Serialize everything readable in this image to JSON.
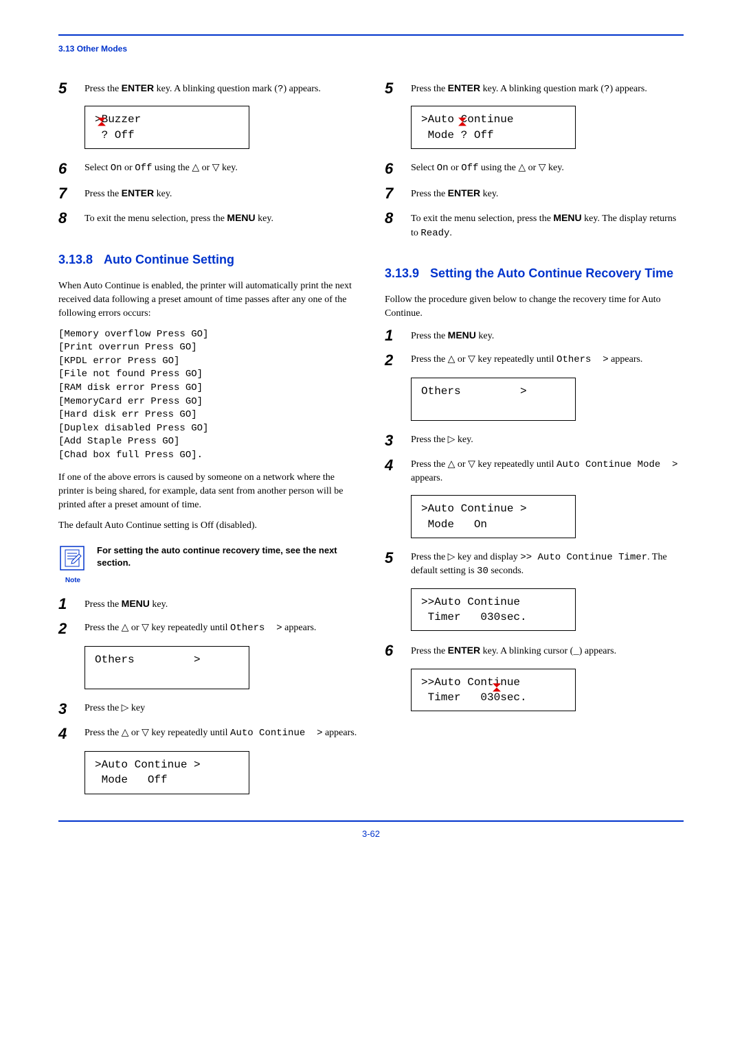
{
  "header": {
    "section_ref": "3.13 Other Modes"
  },
  "left": {
    "step5": {
      "text_a": "Press the ",
      "key": "ENTER",
      "text_b": " key. A blinking question mark (",
      "mark": "?",
      "text_c": ") appears."
    },
    "lcd1_line1": ">Buzzer",
    "lcd1_line2": " ? Off",
    "step6": {
      "text_a": "Select ",
      "mono1": "On",
      "text_b": " or ",
      "mono2": "Off",
      "text_c": " using the △ or ▽ key."
    },
    "step7": {
      "text_a": "Press the ",
      "key": "ENTER",
      "text_b": " key."
    },
    "step8": {
      "text_a": "To exit the menu selection, press the ",
      "key": "MENU",
      "text_b": " key."
    },
    "section8": {
      "num": "3.13.8",
      "title": "Auto Continue Setting"
    },
    "para1": "When Auto Continue is enabled, the printer will automatically print the next received data following a preset amount of time passes after any one of the following errors occurs:",
    "errors": [
      "[Memory overflow Press GO]",
      "[Print overrun Press GO]",
      "[KPDL error Press GO]",
      "[File not found Press GO]",
      "[RAM disk error Press GO]",
      "[MemoryCard err Press GO]",
      "[Hard disk err Press GO]",
      "[Duplex disabled Press GO]",
      "[Add Staple Press GO]",
      "[Chad box full Press GO]."
    ],
    "para2": "If one of the above errors is caused by someone on a network where the printer is being shared, for example, data sent from another person will be printed after a preset amount of time.",
    "para3": "The default Auto Continue setting is Off (disabled).",
    "note": {
      "label": "Note",
      "text": "For setting the auto continue recovery time, see the next section."
    },
    "b_step1": {
      "text_a": "Press the ",
      "key": "MENU",
      "text_b": " key."
    },
    "b_step2": {
      "text_a": "Press the △ or ▽ key repeatedly until ",
      "mono": "Others  >",
      "text_b": " appears."
    },
    "lcd2_line1": "Others         >",
    "lcd2_line2": " ",
    "b_step3": "Press the ▷ key",
    "b_step4": {
      "text_a": "Press the △ or ▽ key repeatedly until ",
      "mono": "Auto Continue  >",
      "text_b": " appears."
    },
    "lcd3_line1": ">Auto Continue >",
    "lcd3_line2": " Mode   Off"
  },
  "right": {
    "step5": {
      "text_a": "Press the ",
      "key": "ENTER",
      "text_b": " key. A blinking question mark (",
      "mark": "?",
      "text_c": ") appears."
    },
    "lcd1_line1": ">Auto Continue",
    "lcd1_line2": " Mode ? Off",
    "step6": {
      "text_a": "Select ",
      "mono1": "On",
      "text_b": " or ",
      "mono2": "Off",
      "text_c": " using the △ or ▽ key."
    },
    "step7": {
      "text_a": "Press the ",
      "key": "ENTER",
      "text_b": " key."
    },
    "step8": {
      "text_a": "To exit the menu selection, press the ",
      "key": "MENU",
      "text_b": " key. The display returns to ",
      "mono": "Ready",
      "text_c": "."
    },
    "section9": {
      "num": "3.13.9",
      "title": "Setting the Auto Continue Recovery Time"
    },
    "para1": "Follow the procedure given below to change the recovery time for Auto Continue.",
    "b_step1": {
      "text_a": "Press the ",
      "key": "MENU",
      "text_b": " key."
    },
    "b_step2": {
      "text_a": "Press the △ or ▽ key repeatedly until ",
      "mono": "Others  >",
      "text_b": " appears."
    },
    "lcd2_line1": "Others         >",
    "lcd2_line2": " ",
    "b_step3": "Press the ▷ key.",
    "b_step4": {
      "text_a": "Press the △ or ▽ key repeatedly until ",
      "mono": "Auto Continue Mode  >",
      "text_b": " appears."
    },
    "lcd3_line1": ">Auto Continue >",
    "lcd3_line2": " Mode   On",
    "b_step5": {
      "text_a": "Press the ▷ key and display ",
      "mono1": ">> Auto Continue Timer",
      "text_b": ". The default setting is ",
      "mono2": "30",
      "text_c": " seconds."
    },
    "lcd4_line1": ">>Auto Continue",
    "lcd4_line2": " Timer   030sec.",
    "b_step6": {
      "text_a": "Press the ",
      "key": "ENTER",
      "text_b": " key. A blinking cursor (",
      "cursor": "_",
      "text_c": ") appears."
    },
    "lcd5_line1": ">>Auto Continue",
    "lcd5_line2": " Timer   030sec."
  },
  "footer": {
    "pagenum": "3-62"
  }
}
